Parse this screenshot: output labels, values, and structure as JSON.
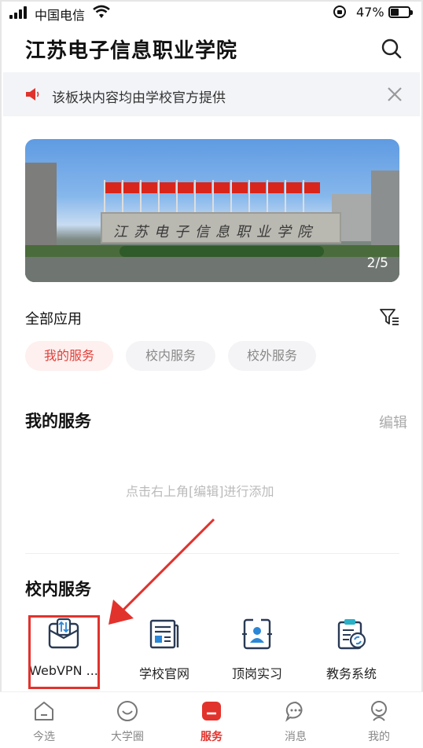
{
  "status_bar": {
    "carrier": "中国电信",
    "battery_pct": "47%",
    "battery_level": 0.47
  },
  "header": {
    "title": "江苏电子信息职业学院",
    "search_icon": "search-icon"
  },
  "notice": {
    "icon": "speaker-icon",
    "text": "该板块内容均由学校官方提供",
    "close_icon": "close-icon"
  },
  "banner": {
    "sign_text": "江苏电子信息职业学院",
    "pager": "2/5"
  },
  "all_apps": {
    "label": "全部应用",
    "filter_icon": "filter-icon",
    "chips": [
      {
        "label": "我的服务",
        "active": true
      },
      {
        "label": "校内服务",
        "active": false
      },
      {
        "label": "校外服务",
        "active": false
      }
    ]
  },
  "my_services": {
    "title": "我的服务",
    "edit_label": "编辑",
    "empty_hint": "点击右上角[编辑]进行添加"
  },
  "campus_services": {
    "title": "校内服务",
    "apps": [
      {
        "label": "WebVPN ...",
        "icon": "webvpn-icon"
      },
      {
        "label": "学校官网",
        "icon": "website-icon"
      },
      {
        "label": "顶岗实习",
        "icon": "internship-icon"
      },
      {
        "label": "教务系统",
        "icon": "academic-system-icon"
      }
    ]
  },
  "tabbar": {
    "tabs": [
      {
        "label": "今选",
        "icon": "home-icon",
        "active": false
      },
      {
        "label": "大学圈",
        "icon": "smile-icon",
        "active": false
      },
      {
        "label": "服务",
        "icon": "service-icon",
        "active": true
      },
      {
        "label": "消息",
        "icon": "message-icon",
        "active": false
      },
      {
        "label": "我的",
        "icon": "profile-icon",
        "active": false
      }
    ]
  },
  "colors": {
    "accent": "#e2322c",
    "chip_active_bg": "#fdf0ef",
    "notice_bg": "#f3f4f8"
  }
}
